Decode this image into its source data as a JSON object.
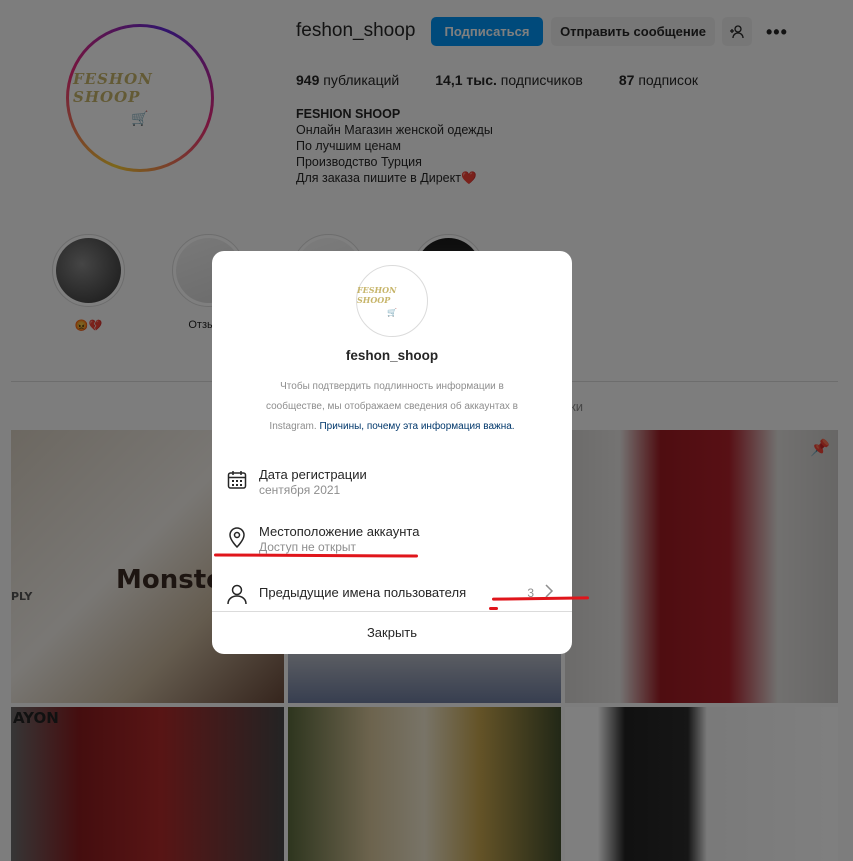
{
  "profile": {
    "username": "feshon_shoop",
    "follow_label": "Подписаться",
    "message_label": "Отправить сообщение",
    "more_label": "•••",
    "logo_text": "FESHON SHOOP",
    "stats": [
      {
        "value": "949",
        "label": "публикаций"
      },
      {
        "value": "14,1 тыс.",
        "label": "подписчиков"
      },
      {
        "value": "87",
        "label": "подписок"
      }
    ],
    "bio": {
      "name": "FESHION SHOOP",
      "lines": [
        "Онлайн Магазин женской одежды",
        "По лучшим ценам",
        "Производство Турция",
        "Для заказа пишите в Директ❤️"
      ]
    }
  },
  "highlights": [
    {
      "label": "😡💔"
    },
    {
      "label": "Отзывы"
    },
    {
      "label": ""
    },
    {
      "label": ""
    }
  ],
  "tab_fragment": "ки",
  "tiles": {
    "t1_text": "Monster",
    "t1_side": "PLY",
    "t4_text": "AYON"
  },
  "modal": {
    "username": "feshon_shoop",
    "description": "Чтобы подтвердить подлинность информации в сообществе, мы отображаем сведения об аккаунтах в Instagram.",
    "description_link": "Причины, почему эта информация важна.",
    "rows": [
      {
        "title": "Дата регистрации",
        "subtitle": "сентября 2021"
      },
      {
        "title": "Местоположение аккаунта",
        "subtitle": "Доступ не открыт"
      },
      {
        "title": "Предыдущие имена пользователя",
        "count": "3"
      }
    ],
    "close_label": "Закрыть"
  },
  "colors": {
    "accent": "#0095f6",
    "annotation": "#e0151b"
  }
}
